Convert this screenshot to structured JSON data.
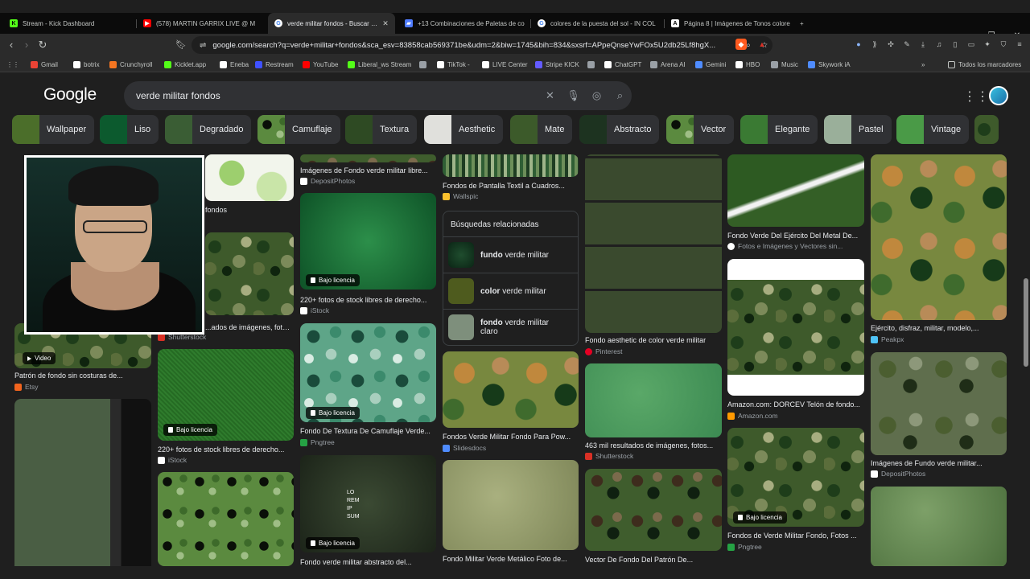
{
  "tabs": [
    {
      "title": "Stream - Kick Dashboard",
      "icon": "kick-icon",
      "color": "#53fc18"
    },
    {
      "title": "(578) MARTIN GARRIX LIVE @ M",
      "icon": "youtube-icon",
      "color": "#ff0000"
    },
    {
      "title": "verde militar fondos - Buscar con",
      "icon": "google-icon",
      "color": "#ffffff",
      "active": true
    },
    {
      "title": "+13 Combinaciones de Paletas de co",
      "icon": "page-icon",
      "color": "#4f7cff"
    },
    {
      "title": "colores de la puesta del sol - IN COL",
      "icon": "google-icon",
      "color": "#ffffff"
    },
    {
      "title": "Página 8 | Imágenes de Tonos colore",
      "icon": "freepik-icon",
      "color": "#ffffff"
    }
  ],
  "toolbar": {
    "url": "google.com/search?q=verde+militar+fondos&sca_esv=83858cab569371be&udm=2&biw=1745&bih=834&sxsrf=APpeQnseYwFOx5U2db25Lf8hgX..."
  },
  "bookmarks": [
    {
      "label": "Gmail",
      "color": "#ea4335"
    },
    {
      "label": "botrix",
      "color": "#ffffff"
    },
    {
      "label": "Crunchyroll",
      "color": "#f47521"
    },
    {
      "label": "Kicklet.app",
      "color": "#53fc18"
    },
    {
      "label": "Eneba",
      "color": "#ffffff"
    },
    {
      "label": "Restream",
      "color": "#3f51ff"
    },
    {
      "label": "YouTube",
      "color": "#ff0000"
    },
    {
      "label": "Liberal_ws Stream",
      "color": "#53fc18"
    },
    {
      "label": "",
      "color": "#9aa0a6"
    },
    {
      "label": "TikTok -",
      "color": "#ffffff"
    },
    {
      "label": "LIVE Center",
      "color": "#ffffff"
    },
    {
      "label": "Stripe KICK",
      "color": "#635bff"
    },
    {
      "label": "",
      "color": "#9aa0a6"
    },
    {
      "label": "ChatGPT",
      "color": "#ffffff"
    },
    {
      "label": "Arena AI",
      "color": "#9aa0a6"
    },
    {
      "label": "Gemini",
      "color": "#4f8cff"
    },
    {
      "label": "HBO",
      "color": "#ffffff"
    },
    {
      "label": "Music",
      "color": "#9aa0a6"
    },
    {
      "label": "Skywork iA",
      "color": "#4f8cff"
    }
  ],
  "bookmarks_all": "Todos los marcadores",
  "google": {
    "logo": "Google",
    "query": "verde militar fondos"
  },
  "chips": [
    "Wallpaper",
    "Liso",
    "Degradado",
    "Camuflaje",
    "Textura",
    "Aesthetic",
    "Mate",
    "Abstracto",
    "Vector",
    "Elegante",
    "Pastel",
    "Vintage"
  ],
  "related": {
    "title": "Búsquedas relacionadas",
    "items": [
      {
        "bold": "fundo",
        "rest": " verde militar"
      },
      {
        "bold": "color",
        "rest": " verde militar"
      },
      {
        "bold": "fondo",
        "rest": " verde militar claro"
      }
    ]
  },
  "results": {
    "video_label": "Video",
    "license": "Bajo licencia",
    "captions": [
      "Imágenes de Fondo verde militar libre...",
      "Fondos de Pantalla Textil a Cuadros...",
      "Fondo Verde Del Ejército Del Metal De...",
      "Ejército, disfraz, militar, modelo,...",
      "fondos",
      "fondos",
      "220+ fotos de stock libres de derecho...",
      "...ados de imágenes, fotos...",
      "Fondo aesthetic de color verde militar",
      "Patrón de fondo sin costuras de...",
      "220+ fotos de stock libres de derecho...",
      "Fondo De Textura De Camuflaje Verde...",
      "Fondos Verde Militar Fondo Para Pow...",
      "463 mil resultados de imágenes, fotos...",
      "Amazon.com: DORCEV Telón de fondo...",
      "Imágenes de Fundo verde militar...",
      "Fondos de Verde Militar Fondo, Fotos ...",
      "Fondo verde militar abstracto del...",
      "Fondo Militar Verde Metálico Foto de...",
      "Vector De Fondo Del Patrón De..."
    ],
    "sources": [
      "DepositPhotos",
      "Wallspic",
      "Fotos e Imágenes y Vectores sin...",
      "Peakpx",
      "iStock",
      "Shutterstock",
      "Pinterest",
      "Etsy",
      "iStock",
      "Pngtree",
      "Slidesdocs",
      "Shutterstock",
      "Amazon.com",
      "DepositPhotos",
      "Pngtree"
    ],
    "lorem": "LO\nREM\nIP\nSUM"
  }
}
